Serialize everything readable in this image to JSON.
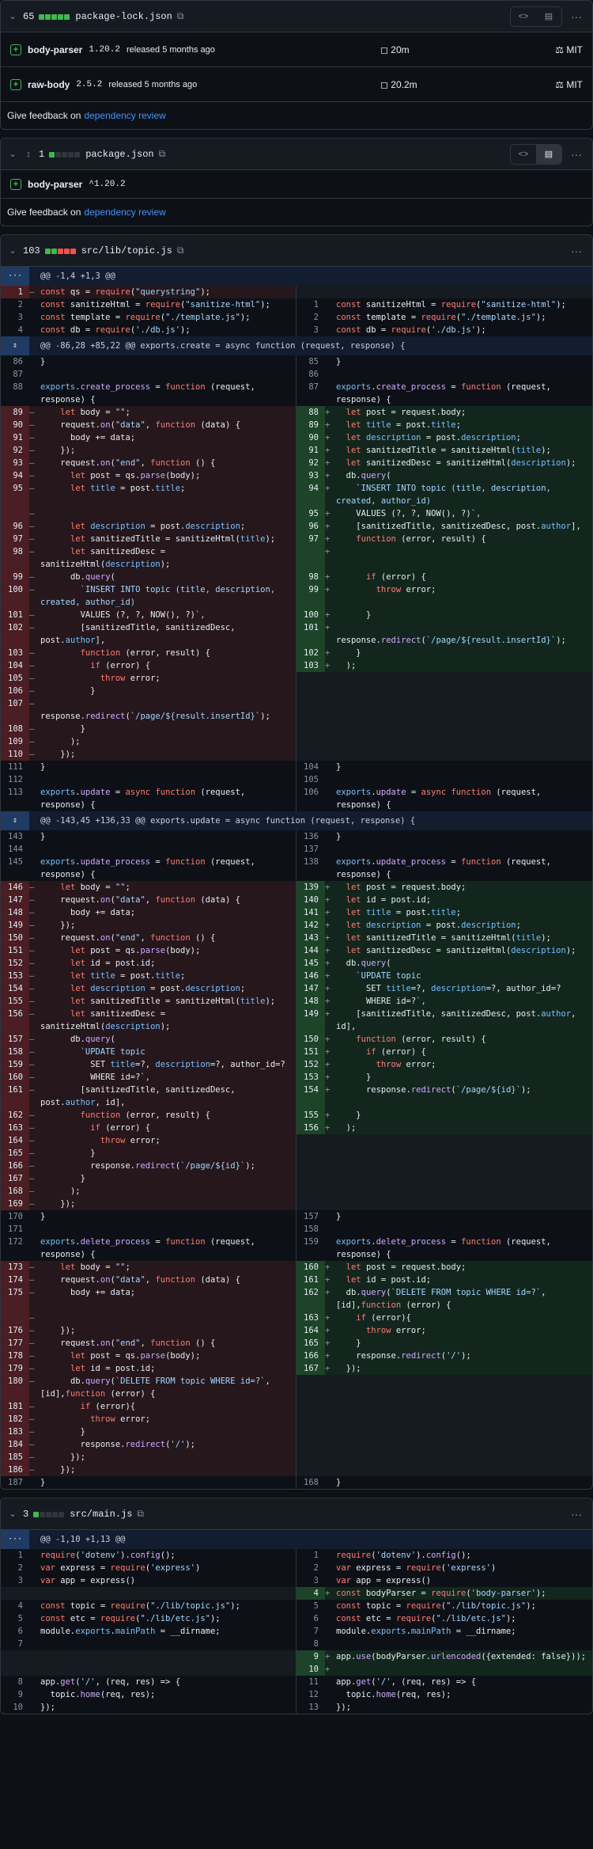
{
  "colors": {
    "added": "#3fb950",
    "removed": "#f85149",
    "neutral": "#8b949e",
    "link": "#4493f8"
  },
  "feedback": {
    "text": "Give feedback on",
    "link": "dependency review"
  },
  "files": [
    {
      "count": "65",
      "path": "package-lock.json",
      "squares": [
        "add",
        "add",
        "add",
        "add",
        "add"
      ],
      "deps": [
        {
          "name": "body-parser",
          "version": "1.20.2",
          "released": "released 5 months ago",
          "size": "20m",
          "license": "MIT"
        },
        {
          "name": "raw-body",
          "version": "2.5.2",
          "released": "released 5 months ago",
          "size": "20.2m",
          "license": "MIT"
        }
      ]
    },
    {
      "count": "1",
      "path": "package.json",
      "squares": [
        "add",
        "neu",
        "neu",
        "neu",
        "neu"
      ],
      "deps": [
        {
          "name": "body-parser",
          "version": "^1.20.2"
        }
      ]
    },
    {
      "count": "103",
      "path": "src/lib/topic.js",
      "squares": [
        "add",
        "add",
        "del",
        "del",
        "del"
      ]
    },
    {
      "count": "3",
      "path": "src/main.js",
      "squares": [
        "add",
        "neu",
        "neu",
        "neu",
        "neu"
      ]
    }
  ],
  "topic_diff": [
    {
      "h": "@@ -1,4 +1,3 @@"
    },
    {
      "l": [
        "1",
        "-",
        "const qs = require(\"querystring\");"
      ]
    },
    {
      "l": [
        "2",
        " ",
        "const sanitizeHtml = require(\"sanitize-html\");"
      ],
      "r": [
        "1",
        " ",
        "const sanitizeHtml = require(\"sanitize-html\");"
      ]
    },
    {
      "l": [
        "3",
        " ",
        "const template = require(\"./template.js\");"
      ],
      "r": [
        "2",
        " ",
        "const template = require(\"./template.js\");"
      ]
    },
    {
      "l": [
        "4",
        " ",
        "const db = require('./db.js');"
      ],
      "r": [
        "3",
        " ",
        "const db = require('./db.js');"
      ]
    },
    {
      "h": "@@ -86,28 +85,22 @@ exports.create = async function (request, response) {"
    },
    {
      "l": [
        "86",
        " ",
        "}"
      ],
      "r": [
        "85",
        " ",
        "}"
      ]
    },
    {
      "l": [
        "87",
        " ",
        ""
      ],
      "r": [
        "86",
        " ",
        ""
      ]
    },
    {
      "l": [
        "88",
        " ",
        "exports.create_process = function (request, response) {"
      ],
      "r": [
        "87",
        " ",
        "exports.create_process = function (request, response) {"
      ]
    },
    {
      "l": [
        "89",
        "-",
        "    let body = \"\";"
      ],
      "r": [
        "88",
        "+",
        "  let post = request.body;"
      ]
    },
    {
      "l": [
        "90",
        "-",
        "    request.on(\"data\", function (data) {"
      ],
      "r": [
        "89",
        "+",
        "  let title = post.title;"
      ]
    },
    {
      "l": [
        "91",
        "-",
        "      body += data;"
      ],
      "r": [
        "90",
        "+",
        "  let description = post.description;"
      ]
    },
    {
      "l": [
        "92",
        "-",
        "    });"
      ],
      "r": [
        "91",
        "+",
        "  let sanitizedTitle = sanitizeHtml(title);"
      ]
    },
    {
      "l": [
        "93",
        "-",
        "    request.on(\"end\", function () {"
      ],
      "r": [
        "92",
        "+",
        "  let sanitizedDesc = sanitizeHtml(description);"
      ]
    },
    {
      "l": [
        "94",
        "-",
        "      let post = qs.parse(body);"
      ],
      "r": [
        "93",
        "+",
        "  db.query("
      ]
    },
    {
      "l": [
        "95",
        "-",
        "      let title = post.title;"
      ],
      "r": [
        "94",
        "+",
        "    `INSERT INTO topic (title, description, created, author_id)"
      ]
    },
    {
      "l": [
        "",
        "-",
        ""
      ],
      "r": [
        "95",
        "+",
        "    VALUES (?, ?, NOW(), ?)`,"
      ]
    },
    {
      "l": [
        "96",
        "-",
        "      let description = post.description;"
      ],
      "r": [
        "96",
        "+",
        "    [sanitizedTitle, sanitizedDesc, post.author],"
      ]
    },
    {
      "l": [
        "97",
        "-",
        "      let sanitizedTitle = sanitizeHtml(title);"
      ],
      "r": [
        "97",
        "+",
        "    function (error, result) {"
      ]
    },
    {
      "l": [
        "98",
        "-",
        "      let sanitizedDesc = sanitizeHtml(description);"
      ],
      "r": [
        "",
        "+",
        ""
      ]
    },
    {
      "l": [
        "99",
        "-",
        "      db.query("
      ],
      "r": [
        "98",
        "+",
        "      if (error) {"
      ]
    },
    {
      "l": [
        "100",
        "-",
        "        `INSERT INTO topic (title, description, created, author_id)"
      ],
      "r": [
        "99",
        "+",
        "        throw error;"
      ]
    },
    {
      "l": [
        "101",
        "-",
        "        VALUES (?, ?, NOW(), ?)`,"
      ],
      "r": [
        "100",
        "+",
        "      }"
      ]
    },
    {
      "l": [
        "102",
        "-",
        "        [sanitizedTitle, sanitizedDesc, post.author],"
      ],
      "r": [
        "101",
        "+",
        "      response.redirect(`/page/${result.insertId}`);"
      ]
    },
    {
      "l": [
        "103",
        "-",
        "        function (error, result) {"
      ],
      "r": [
        "102",
        "+",
        "    }"
      ]
    },
    {
      "l": [
        "104",
        "-",
        "          if (error) {"
      ],
      "r": [
        "103",
        "+",
        "  );"
      ]
    },
    {
      "l": [
        "105",
        "-",
        "            throw error;"
      ]
    },
    {
      "l": [
        "106",
        "-",
        "          }"
      ]
    },
    {
      "l": [
        "107",
        "-",
        "          response.redirect(`/page/${result.insertId}`);"
      ]
    },
    {
      "l": [
        "108",
        "-",
        "        }"
      ]
    },
    {
      "l": [
        "109",
        "-",
        "      );"
      ]
    },
    {
      "l": [
        "110",
        "-",
        "    });"
      ]
    },
    {
      "l": [
        "111",
        " ",
        "}"
      ],
      "r": [
        "104",
        " ",
        "}"
      ]
    },
    {
      "l": [
        "112",
        " ",
        ""
      ],
      "r": [
        "105",
        " ",
        ""
      ]
    },
    {
      "l": [
        "113",
        " ",
        "exports.update = async function (request, response) {"
      ],
      "r": [
        "106",
        " ",
        "exports.update = async function (request, response) {"
      ]
    },
    {
      "h": "@@ -143,45 +136,33 @@ exports.update = async function (request, response) {"
    },
    {
      "l": [
        "143",
        " ",
        "}"
      ],
      "r": [
        "136",
        " ",
        "}"
      ]
    },
    {
      "l": [
        "144",
        " ",
        ""
      ],
      "r": [
        "137",
        " ",
        ""
      ]
    },
    {
      "l": [
        "145",
        " ",
        "exports.update_process = function (request, response) {"
      ],
      "r": [
        "138",
        " ",
        "exports.update_process = function (request, response) {"
      ]
    },
    {
      "l": [
        "146",
        "-",
        "    let body = \"\";"
      ],
      "r": [
        "139",
        "+",
        "  let post = request.body;"
      ]
    },
    {
      "l": [
        "147",
        "-",
        "    request.on(\"data\", function (data) {"
      ],
      "r": [
        "140",
        "+",
        "  let id = post.id;"
      ]
    },
    {
      "l": [
        "148",
        "-",
        "      body += data;"
      ],
      "r": [
        "141",
        "+",
        "  let title = post.title;"
      ]
    },
    {
      "l": [
        "149",
        "-",
        "    });"
      ],
      "r": [
        "142",
        "+",
        "  let description = post.description;"
      ]
    },
    {
      "l": [
        "150",
        "-",
        "    request.on(\"end\", function () {"
      ],
      "r": [
        "143",
        "+",
        "  let sanitizedTitle = sanitizeHtml(title);"
      ]
    },
    {
      "l": [
        "151",
        "-",
        "      let post = qs.parse(body);"
      ],
      "r": [
        "144",
        "+",
        "  let sanitizedDesc = sanitizeHtml(description);"
      ]
    },
    {
      "l": [
        "152",
        "-",
        "      let id = post.id;"
      ],
      "r": [
        "145",
        "+",
        "  db.query("
      ]
    },
    {
      "l": [
        "153",
        "-",
        "      let title = post.title;"
      ],
      "r": [
        "146",
        "+",
        "    `UPDATE topic"
      ]
    },
    {
      "l": [
        "154",
        "-",
        "      let description = post.description;"
      ],
      "r": [
        "147",
        "+",
        "      SET title=?, description=?, author_id=?"
      ]
    },
    {
      "l": [
        "155",
        "-",
        "      let sanitizedTitle = sanitizeHtml(title);"
      ],
      "r": [
        "148",
        "+",
        "      WHERE id=?`,"
      ]
    },
    {
      "l": [
        "156",
        "-",
        "      let sanitizedDesc = sanitizeHtml(description);"
      ],
      "r": [
        "149",
        "+",
        "    [sanitizedTitle, sanitizedDesc, post.author, id],"
      ]
    },
    {
      "l": [
        "157",
        "-",
        "      db.query("
      ],
      "r": [
        "150",
        "+",
        "    function (error, result) {"
      ]
    },
    {
      "l": [
        "158",
        "-",
        "        `UPDATE topic"
      ],
      "r": [
        "151",
        "+",
        "      if (error) {"
      ]
    },
    {
      "l": [
        "159",
        "-",
        "          SET title=?, description=?, author_id=?"
      ],
      "r": [
        "152",
        "+",
        "        throw error;"
      ]
    },
    {
      "l": [
        "160",
        "-",
        "          WHERE id=?`,"
      ],
      "r": [
        "153",
        "+",
        "      }"
      ]
    },
    {
      "l": [
        "161",
        "-",
        "        [sanitizedTitle, sanitizedDesc, post.author, id],"
      ],
      "r": [
        "154",
        "+",
        "      response.redirect(`/page/${id}`);"
      ]
    },
    {
      "l": [
        "162",
        "-",
        "        function (error, result) {"
      ],
      "r": [
        "155",
        "+",
        "    }"
      ]
    },
    {
      "l": [
        "163",
        "-",
        "          if (error) {"
      ],
      "r": [
        "156",
        "+",
        "  );"
      ]
    },
    {
      "l": [
        "164",
        "-",
        "            throw error;"
      ]
    },
    {
      "l": [
        "165",
        "-",
        "          }"
      ]
    },
    {
      "l": [
        "166",
        "-",
        "          response.redirect(`/page/${id}`);"
      ]
    },
    {
      "l": [
        "167",
        "-",
        "        }"
      ]
    },
    {
      "l": [
        "168",
        "-",
        "      );"
      ]
    },
    {
      "l": [
        "169",
        "-",
        "    });"
      ]
    },
    {
      "l": [
        "170",
        " ",
        "}"
      ],
      "r": [
        "157",
        " ",
        "}"
      ]
    },
    {
      "l": [
        "171",
        " ",
        ""
      ],
      "r": [
        "158",
        " ",
        ""
      ]
    },
    {
      "l": [
        "172",
        " ",
        "exports.delete_process = function (request, response) {"
      ],
      "r": [
        "159",
        " ",
        "exports.delete_process = function (request, response) {"
      ]
    },
    {
      "l": [
        "173",
        "-",
        "    let body = \"\";"
      ],
      "r": [
        "160",
        "+",
        "  let post = request.body;"
      ]
    },
    {
      "l": [
        "174",
        "-",
        "    request.on(\"data\", function (data) {"
      ],
      "r": [
        "161",
        "+",
        "  let id = post.id;"
      ]
    },
    {
      "l": [
        "175",
        "-",
        "      body += data;"
      ],
      "r": [
        "162",
        "+",
        "  db.query(`DELETE FROM topic WHERE id=?`, [id],function (error) {"
      ]
    },
    {
      "l": [
        "",
        "-",
        ""
      ],
      "r": [
        "163",
        "+",
        "    if (error){"
      ]
    },
    {
      "l": [
        "176",
        "-",
        "    });"
      ],
      "r": [
        "164",
        "+",
        "      throw error;"
      ]
    },
    {
      "l": [
        "177",
        "-",
        "    request.on(\"end\", function () {"
      ],
      "r": [
        "165",
        "+",
        "    }"
      ]
    },
    {
      "l": [
        "178",
        "-",
        "      let post = qs.parse(body);"
      ],
      "r": [
        "166",
        "+",
        "    response.redirect('/');"
      ]
    },
    {
      "l": [
        "179",
        "-",
        "      let id = post.id;"
      ],
      "r": [
        "167",
        "+",
        "  });"
      ]
    },
    {
      "l": [
        "180",
        "-",
        "      db.query(`DELETE FROM topic WHERE id=?`, [id],function (error) {"
      ]
    },
    {
      "l": [
        "181",
        "-",
        "        if (error){"
      ]
    },
    {
      "l": [
        "182",
        "-",
        "          throw error;"
      ]
    },
    {
      "l": [
        "183",
        "-",
        "        }"
      ]
    },
    {
      "l": [
        "184",
        "-",
        "        response.redirect('/');"
      ]
    },
    {
      "l": [
        "185",
        "-",
        "      });"
      ]
    },
    {
      "l": [
        "186",
        "-",
        "    });"
      ]
    },
    {
      "l": [
        "187",
        " ",
        "}"
      ],
      "r": [
        "168",
        " ",
        "}"
      ]
    }
  ],
  "main_diff": [
    {
      "h": "@@ -1,10 +1,13 @@"
    },
    {
      "l": [
        "1",
        " ",
        "require('dotenv').config();"
      ],
      "r": [
        "1",
        " ",
        "require('dotenv').config();"
      ]
    },
    {
      "l": [
        "2",
        " ",
        "var express = require('express')"
      ],
      "r": [
        "2",
        " ",
        "var express = require('express')"
      ]
    },
    {
      "l": [
        "3",
        " ",
        "var app = express()"
      ],
      "r": [
        "3",
        " ",
        "var app = express()"
      ]
    },
    {
      "l": [
        "",
        "e",
        ""
      ],
      "r": [
        "4",
        "+",
        "const bodyParser = require('body-parser');"
      ]
    },
    {
      "l": [
        "4",
        " ",
        "const topic = require(\"./lib/topic.js\");"
      ],
      "r": [
        "5",
        " ",
        "const topic = require(\"./lib/topic.js\");"
      ]
    },
    {
      "l": [
        "5",
        " ",
        "const etc = require(\"./lib/etc.js\");"
      ],
      "r": [
        "6",
        " ",
        "const etc = require(\"./lib/etc.js\");"
      ]
    },
    {
      "l": [
        "6",
        " ",
        "module.exports.mainPath = __dirname;"
      ],
      "r": [
        "7",
        " ",
        "module.exports.mainPath = __dirname;"
      ]
    },
    {
      "l": [
        "7",
        " ",
        ""
      ],
      "r": [
        "8",
        " ",
        ""
      ]
    },
    {
      "l": [
        "",
        "e",
        ""
      ],
      "r": [
        "9",
        "+",
        "app.use(bodyParser.urlencoded({extended: false}));"
      ]
    },
    {
      "l": [
        "",
        "e",
        ""
      ],
      "r": [
        "10",
        "+",
        ""
      ]
    },
    {
      "l": [
        "8",
        " ",
        "app.get('/', (req, res) => {"
      ],
      "r": [
        "11",
        " ",
        "app.get('/', (req, res) => {"
      ]
    },
    {
      "l": [
        "9",
        " ",
        "  topic.home(req, res);"
      ],
      "r": [
        "12",
        " ",
        "  topic.home(req, res);"
      ]
    },
    {
      "l": [
        "10",
        " ",
        "});"
      ],
      "r": [
        "13",
        " ",
        "});"
      ]
    }
  ]
}
